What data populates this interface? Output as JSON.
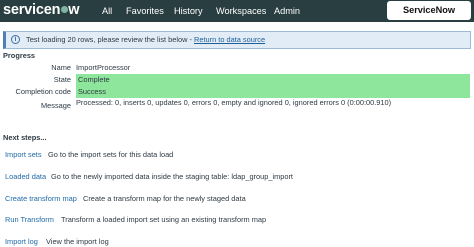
{
  "nav": {
    "brand": "servicenow",
    "links": [
      "All",
      "Favorites",
      "History",
      "Workspaces",
      "Admin"
    ],
    "instance_button": "ServiceNow"
  },
  "info": {
    "text": "Test loading 20 rows, please review the list below -",
    "link": "Return to data source"
  },
  "progress": {
    "title": "Progress",
    "fields": [
      {
        "label": "Name",
        "value": "ImportProcessor"
      },
      {
        "label": "State",
        "value": "Complete"
      },
      {
        "label": "Completion code",
        "value": "Success"
      },
      {
        "label": "Message",
        "value": "Processed: 0, inserts 0, updates 0, errors 0, empty and ignored 0, ignored errors 0  (0:00:00.910)"
      }
    ]
  },
  "next_steps": {
    "title": "Next steps...",
    "items": [
      {
        "link": "Import sets",
        "description": "Go to the import sets for this data load"
      },
      {
        "link": "Loaded data",
        "description": "Go to the newly imported data inside the staging table: ldap_group_import"
      },
      {
        "link": "Create transform map",
        "description": "Create a transform map for the newly staged data"
      },
      {
        "link": "Run Transform",
        "description": "Transform a loaded import set using an existing transform map"
      },
      {
        "link": "Import log",
        "description": "View the import log"
      }
    ]
  },
  "colors": {
    "nav_bg": "#293e40",
    "success_bg": "#8ee69c",
    "link": "#1f6aa8",
    "info_bg": "#e1ecf6"
  }
}
